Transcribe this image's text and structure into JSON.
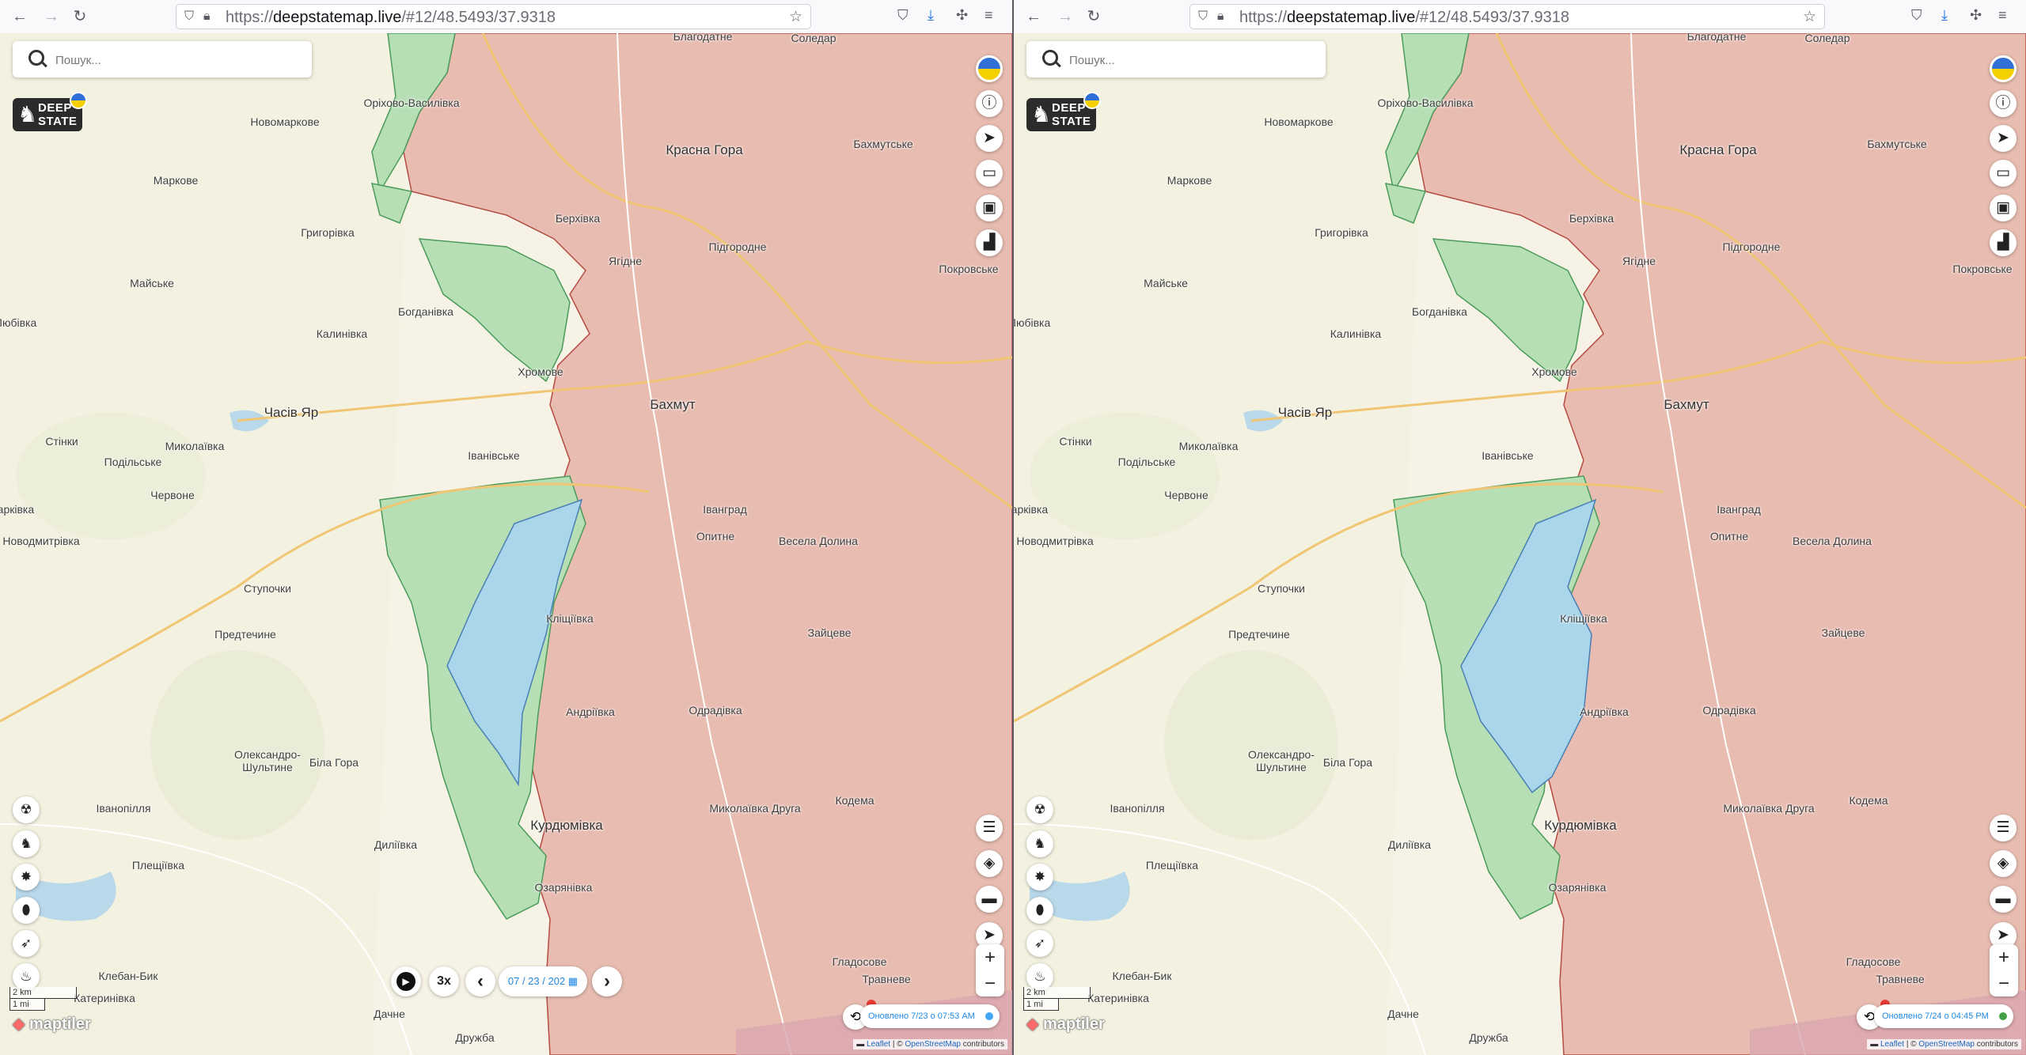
{
  "browser": {
    "back_icon": "back-arrow-icon",
    "forward_icon": "forward-arrow-icon",
    "reload_icon": "reload-icon",
    "url_prefix": "https://",
    "url_domain": "deepstatemap.live",
    "url_path": "/#12/48.5493/37.9318"
  },
  "search": {
    "placeholder": "Пошук..."
  },
  "logo": {
    "line1": "DEEP",
    "line2": "STATE"
  },
  "places": [
    {
      "name": "Благодатне",
      "big": false
    },
    {
      "name": "Соледар",
      "big": false
    },
    {
      "name": "Оріхово-Василівка",
      "big": false
    },
    {
      "name": "Новомаркове",
      "big": false
    },
    {
      "name": "Красна Гора",
      "big": true
    },
    {
      "name": "Бахмутське",
      "big": false
    },
    {
      "name": "Маркове",
      "big": false
    },
    {
      "name": "Берхівка",
      "big": false
    },
    {
      "name": "Григорівка",
      "big": false
    },
    {
      "name": "Підгородне",
      "big": false
    },
    {
      "name": "Ягідне",
      "big": false
    },
    {
      "name": "Покровське",
      "big": false
    },
    {
      "name": "Майське",
      "big": false
    },
    {
      "name": "Богданівка",
      "big": false
    },
    {
      "name": "Любівка",
      "big": false
    },
    {
      "name": "Калинівка",
      "big": false
    },
    {
      "name": "Хромове",
      "big": false
    },
    {
      "name": "Бахмут",
      "big": true
    },
    {
      "name": "Часів Яр",
      "big": true
    },
    {
      "name": "Стінки",
      "big": false
    },
    {
      "name": "Миколаївка",
      "big": false
    },
    {
      "name": "Подільське",
      "big": false
    },
    {
      "name": "Іванівське",
      "big": false
    },
    {
      "name": "Червоне",
      "big": false
    },
    {
      "name": "Іванград",
      "big": false
    },
    {
      "name": "Марківка",
      "big": false
    },
    {
      "name": "Опитне",
      "big": false
    },
    {
      "name": "Весела Долина",
      "big": false
    },
    {
      "name": "Новодмитрівка",
      "big": false
    },
    {
      "name": "Ступочки",
      "big": false
    },
    {
      "name": "Кліщіївка",
      "big": false
    },
    {
      "name": "Предтечине",
      "big": false
    },
    {
      "name": "Зайцеве",
      "big": false
    },
    {
      "name": "Андріївка",
      "big": false
    },
    {
      "name": "Одрадівка",
      "big": false
    },
    {
      "name": "Олександро-",
      "big": false
    },
    {
      "name": "Шультине",
      "big": false
    },
    {
      "name": "Біла Гора",
      "big": false
    },
    {
      "name": "Іванопілля",
      "big": false
    },
    {
      "name": "Миколаївка Друга",
      "big": false
    },
    {
      "name": "Кодема",
      "big": false
    },
    {
      "name": "Курдюмівка",
      "big": true
    },
    {
      "name": "Диліївка",
      "big": false
    },
    {
      "name": "Плещіївка",
      "big": false
    },
    {
      "name": "Озарянівка",
      "big": false
    },
    {
      "name": "Гладосове",
      "big": false
    },
    {
      "name": "Клебан-Бик",
      "big": false
    },
    {
      "name": "Травневе",
      "big": false
    },
    {
      "name": "Катеринівка",
      "big": false
    },
    {
      "name": "Дачне",
      "big": false
    },
    {
      "name": "Дружба",
      "big": false
    }
  ],
  "right_buttons": [
    {
      "name": "ukraine-flag-icon",
      "glyph": ""
    },
    {
      "name": "info-icon",
      "glyph": "ⓘ"
    },
    {
      "name": "telegram-icon",
      "glyph": "➤"
    },
    {
      "name": "donate-icon",
      "glyph": "▭"
    },
    {
      "name": "bot-icon",
      "glyph": "▣"
    },
    {
      "name": "stats-icon",
      "glyph": "▟"
    }
  ],
  "right_tools": [
    {
      "name": "filters-icon",
      "glyph": "☰"
    },
    {
      "name": "layers-icon",
      "glyph": "◈"
    },
    {
      "name": "ruler-icon",
      "glyph": "▬"
    },
    {
      "name": "locate-icon",
      "glyph": "➤"
    }
  ],
  "left_tools": [
    {
      "name": "radiation-icon",
      "glyph": "☢"
    },
    {
      "name": "soldier-icon",
      "glyph": "♞"
    },
    {
      "name": "explosion-icon",
      "glyph": "✸"
    },
    {
      "name": "pills-icon",
      "glyph": "⬮"
    },
    {
      "name": "rocket-icon",
      "glyph": "➶"
    },
    {
      "name": "fire-icon",
      "glyph": "♨"
    }
  ],
  "timeline": {
    "play_icon": "▶",
    "speed": "3x",
    "prev": "‹",
    "next": "›",
    "date": "07 / 23 / 202"
  },
  "scale": {
    "km": "2 km",
    "mi": "1 mi"
  },
  "maptiler_label": "maptiler",
  "attribution": {
    "leaflet": "Leaflet",
    "sep": " | © ",
    "osm": "OpenStreetMap",
    "contributors": " contributors"
  },
  "zoom": {
    "in": "+",
    "out": "−"
  },
  "left_panel": {
    "updated": "Оновлено 7/23 о 07:53 AM",
    "dot_color": "#42a5f5"
  },
  "right_panel": {
    "updated": "Оновлено 7/24 о 04:45 PM",
    "dot_color": "#43a047"
  },
  "colors": {
    "occupied": "#e8b9b0",
    "liberated": "#a8d8e8",
    "contested": "#b7dfb5",
    "land": "#f6f3e6"
  }
}
